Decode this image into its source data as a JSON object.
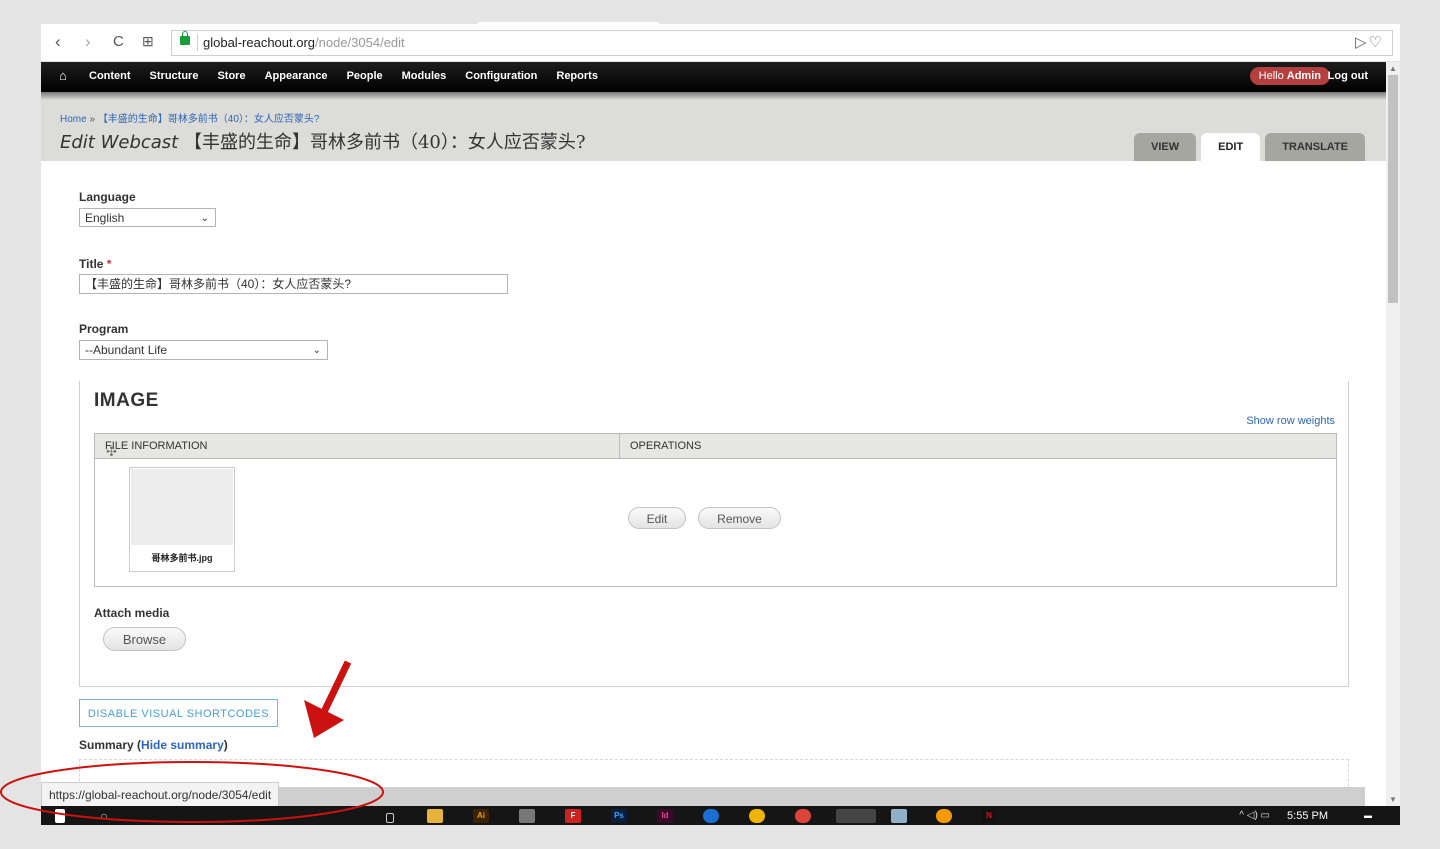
{
  "browser": {
    "url_host": "global-reachout.org",
    "url_path": "/node/3054/edit",
    "nav_back": "‹",
    "nav_forward": "›",
    "nav_reload": "C",
    "nav_apps": "⊞",
    "right_icons": "▷♡"
  },
  "toolbar": {
    "items": [
      "Content",
      "Structure",
      "Store",
      "Appearance",
      "People",
      "Modules",
      "Configuration",
      "Reports"
    ],
    "hello_prefix": "Hello ",
    "hello_user": "Admin",
    "logout": "Log out"
  },
  "header": {
    "breadcrumb_home": "Home",
    "breadcrumb_sep": "»",
    "breadcrumb_current": "【丰盛的生命】哥林多前书（40）：女人应否蒙头?",
    "title_prefix": "Edit Webcast",
    "title_text": "【丰盛的生命】哥林多前书（40）：女人应否蒙头?",
    "tabs": [
      "VIEW",
      "EDIT",
      "TRANSLATE"
    ],
    "active_tab": "EDIT"
  },
  "form": {
    "language_label": "Language",
    "language_value": "English",
    "title_label": "Title",
    "required_mark": "*",
    "title_value": "【丰盛的生命】哥林多前书（40）：女人应否蒙头?",
    "program_label": "Program",
    "program_value": "--Abundant Life",
    "image_heading": "IMAGE",
    "show_row_weights": "Show row weights",
    "col_file": "FILE INFORMATION",
    "col_ops": "OPERATIONS",
    "file_name": "哥林多前书.jpg",
    "edit_btn": "Edit",
    "remove_btn": "Remove",
    "attach_label": "Attach media",
    "browse_btn": "Browse",
    "disable_shortcodes": "DISABLE VISUAL SHORTCODES",
    "summary_label": "Summary",
    "summary_open": " (",
    "hide_summary": "Hide summary",
    "summary_close": ")"
  },
  "status_bar": {
    "url": "https://global-reachout.org/node/3054/edit"
  },
  "taskbar": {
    "time": "5:55 PM",
    "tray": "^ ◁) ▭"
  },
  "colors": {
    "admin_bg": "#000000",
    "hello_badge": "#b43f3f",
    "link": "#2f65b5",
    "annotation": "#cc1111"
  }
}
